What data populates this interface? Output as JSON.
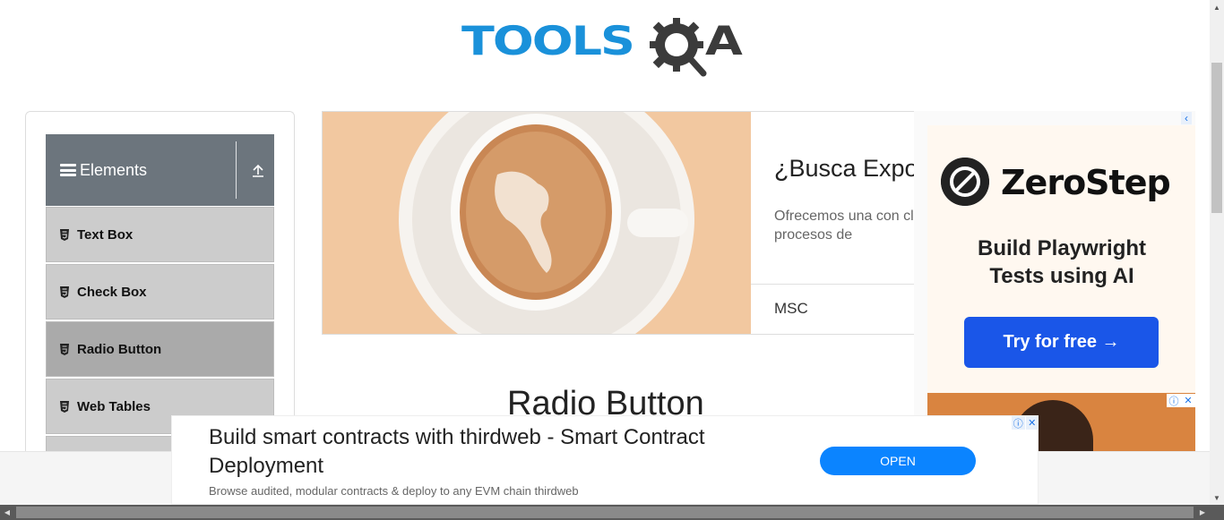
{
  "logo": {
    "text": "TOOLS",
    "suffix": "A"
  },
  "sidebar": {
    "group_title": "Elements",
    "items": [
      {
        "label": "Text Box"
      },
      {
        "label": "Check Box"
      },
      {
        "label": "Radio Button"
      },
      {
        "label": "Web Tables"
      }
    ]
  },
  "banner": {
    "headline": "¿Busca Expo",
    "description": "Ofrecemos una con clase y procesos de",
    "brand": "MSC"
  },
  "main": {
    "title": "Radio Button"
  },
  "right_ad": {
    "brand": "ZeroStep",
    "tagline": "Build Playwright Tests using AI",
    "cta": "Try for free →"
  },
  "bottom_ad": {
    "headline": "Build smart contracts with thirdweb - Smart Contract Deployment",
    "subtext": "Browse audited, modular contracts & deploy to any EVM chain thirdweb",
    "cta": "OPEN"
  },
  "colors": {
    "logo_blue": "#1a91da",
    "sidebar_header": "#6c757d",
    "menu_bg": "#cccccc",
    "menu_active": "#aaaaaa",
    "cta_blue": "#1a56e8",
    "open_blue": "#0b84ff"
  }
}
